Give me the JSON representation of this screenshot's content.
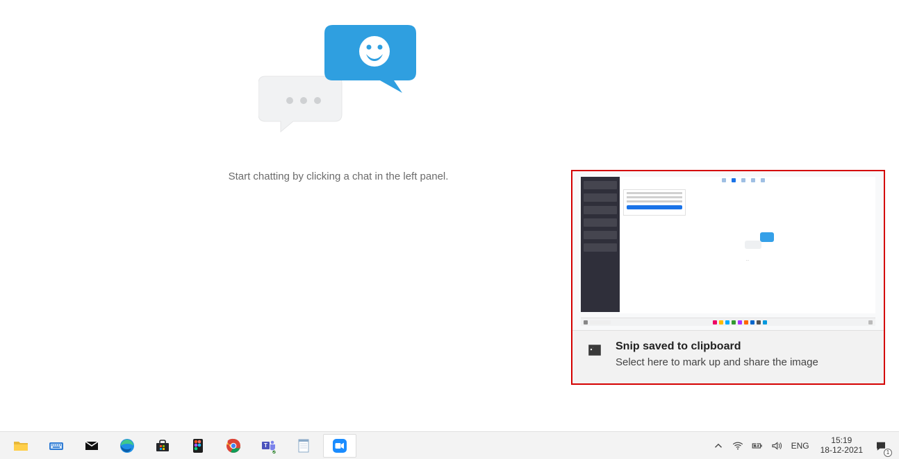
{
  "main": {
    "hint": "Start chatting by clicking a chat in the left panel."
  },
  "notification": {
    "title": "Snip saved to clipboard",
    "description": "Select here to mark up and share the image"
  },
  "taskbar": {
    "apps": [
      {
        "name": "file-explorer"
      },
      {
        "name": "screenkey"
      },
      {
        "name": "mail"
      },
      {
        "name": "edge"
      },
      {
        "name": "microsoft-store"
      },
      {
        "name": "figma"
      },
      {
        "name": "chrome"
      },
      {
        "name": "teams"
      },
      {
        "name": "notepad"
      },
      {
        "name": "zoom",
        "active": true
      }
    ]
  },
  "tray": {
    "language": "ENG",
    "time": "15:19",
    "date": "18-12-2021",
    "notification_count": "1"
  }
}
